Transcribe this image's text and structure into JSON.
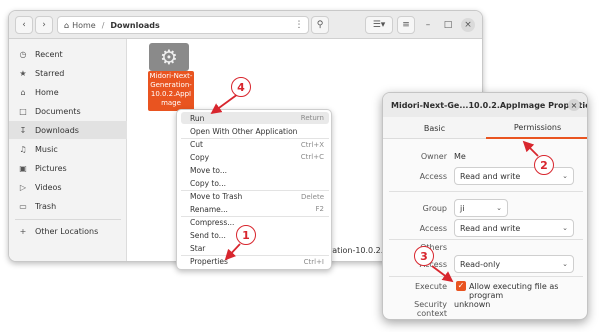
{
  "file_manager": {
    "path": {
      "home": "Home",
      "current": "Downloads"
    },
    "sidebar": [
      {
        "label": "Recent",
        "icon": "clock-icon"
      },
      {
        "label": "Starred",
        "icon": "star-icon"
      },
      {
        "label": "Home",
        "icon": "home-icon"
      },
      {
        "label": "Documents",
        "icon": "document-icon"
      },
      {
        "label": "Downloads",
        "icon": "download-icon",
        "active": true
      },
      {
        "label": "Music",
        "icon": "music-icon"
      },
      {
        "label": "Pictures",
        "icon": "picture-icon"
      },
      {
        "label": "Videos",
        "icon": "video-icon"
      },
      {
        "label": "Trash",
        "icon": "trash-icon"
      },
      {
        "label": "Other Locations",
        "icon": "plus-icon"
      }
    ],
    "file": {
      "name": "Midori-Next-Generation-10.0.2.AppImage",
      "icon": "gear-icon"
    },
    "status_fragment": "eration-10.0.2.Ap"
  },
  "context_menu": {
    "items": [
      {
        "label": "Run",
        "shortcut": "Return"
      },
      {
        "label": "Open With Other Application",
        "shortcut": ""
      },
      {
        "label": "Cut",
        "shortcut": "Ctrl+X"
      },
      {
        "label": "Copy",
        "shortcut": "Ctrl+C"
      },
      {
        "label": "Move to...",
        "shortcut": ""
      },
      {
        "label": "Copy to...",
        "shortcut": ""
      },
      {
        "label": "Move to Trash",
        "shortcut": "Delete"
      },
      {
        "label": "Rename...",
        "shortcut": "F2"
      },
      {
        "label": "Compress...",
        "shortcut": ""
      },
      {
        "label": "Send to...",
        "shortcut": ""
      },
      {
        "label": "Star",
        "shortcut": ""
      },
      {
        "label": "Properties",
        "shortcut": "Ctrl+I"
      }
    ]
  },
  "properties": {
    "title": "Midori-Next-Ge...10.0.2.AppImage Properties",
    "close": "×",
    "tabs": [
      "Basic",
      "Permissions"
    ],
    "owner_label": "Owner",
    "owner_value": "Me",
    "access_label": "Access",
    "owner_access": "Read and write",
    "group_label": "Group",
    "group_value": "ji",
    "group_access": "Read and write",
    "others_label": "Others",
    "others_access": "Read-only",
    "execute_label": "Execute",
    "execute_text": "Allow executing file as program",
    "execute_checked": true,
    "security_label": "Security context",
    "security_value": "unknown"
  },
  "callouts": [
    "1",
    "2",
    "3",
    "4"
  ],
  "colors": {
    "accent": "#e95420",
    "callout": "#d8262e"
  }
}
